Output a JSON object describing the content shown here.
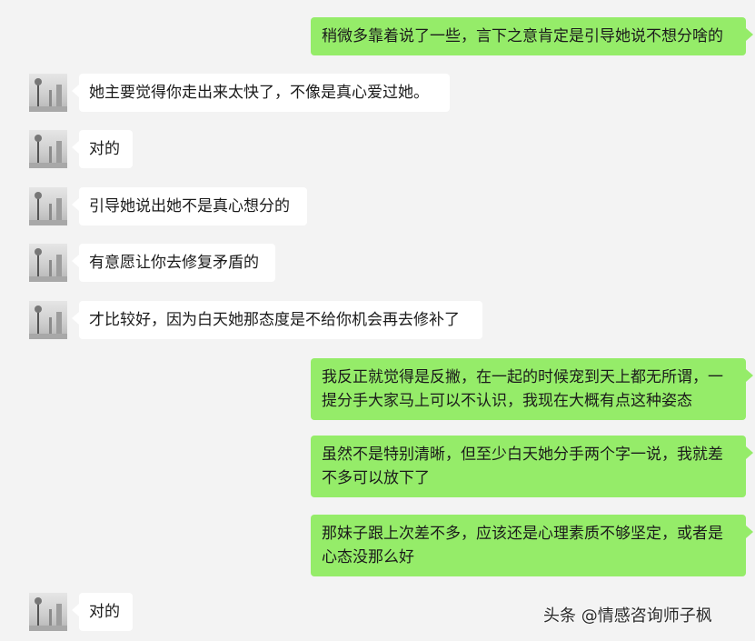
{
  "messages": [
    {
      "side": "out",
      "text": "稍微多靠着说了一些，言下之意肯定是引导她说不想分啥的"
    },
    {
      "side": "in",
      "text": "她主要觉得你走出来太快了，不像是真心爱过她。"
    },
    {
      "side": "in",
      "text": "对的"
    },
    {
      "side": "in",
      "text": "引导她说出她不是真心想分的"
    },
    {
      "side": "in",
      "text": "有意愿让你去修复矛盾的"
    },
    {
      "side": "in",
      "text": "才比较好，因为白天她那态度是不给你机会再去修补了"
    },
    {
      "side": "out",
      "text": "我反正就觉得是反撇，在一起的时候宠到天上都无所谓，一提分手大家马上可以不认识，我现在大概有点这种姿态"
    },
    {
      "side": "out",
      "text": "虽然不是特别清晰，但至少白天她分手两个字一说，我就差不多可以放下了"
    },
    {
      "side": "out",
      "text": "那妹子跟上次差不多，应该还是心理素质不够坚定，或者是心态没那么好"
    },
    {
      "side": "in",
      "text": "对的"
    }
  ],
  "watermark": "头条 @情感咨询师子枫",
  "colors": {
    "background": "#f3f3f3",
    "incoming_bubble": "#ffffff",
    "outgoing_bubble": "#95ec69"
  },
  "avatar_icon": "contact-avatar-icon"
}
